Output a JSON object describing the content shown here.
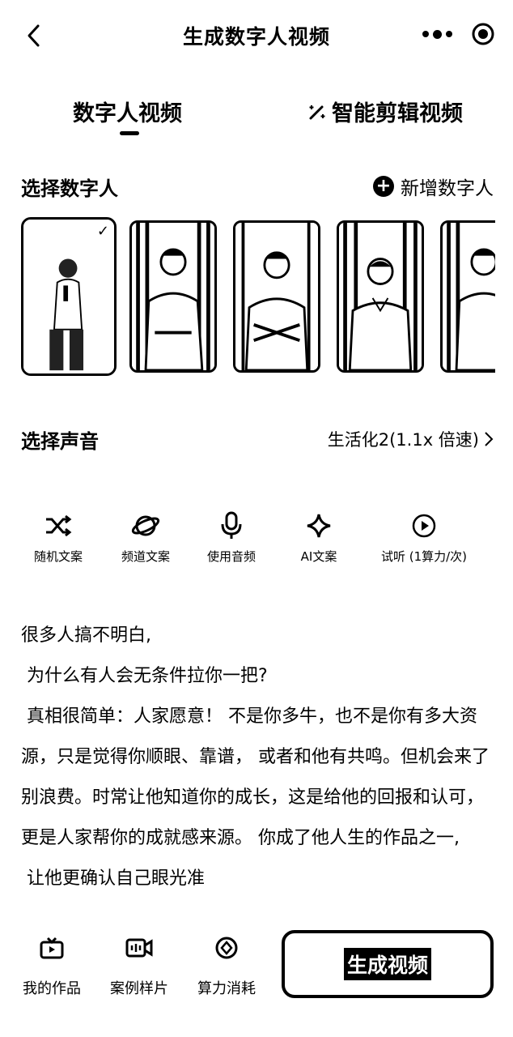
{
  "header": {
    "title": "生成数字人视频"
  },
  "tabs": [
    {
      "label": "数字人视频",
      "active": true
    },
    {
      "label": "智能剪辑视频",
      "active": false
    }
  ],
  "avatar_section": {
    "title": "选择数字人",
    "add_label": "新增数字人",
    "selected_index": 0
  },
  "voice_section": {
    "title": "选择声音",
    "value": "生活化2(1.1x 倍速)"
  },
  "tools": [
    {
      "label": "随机文案",
      "icon": "shuffle-icon"
    },
    {
      "label": "频道文案",
      "icon": "planet-icon"
    },
    {
      "label": "使用音频",
      "icon": "microphone-icon"
    },
    {
      "label": "AI文案",
      "icon": "sparkle-icon"
    },
    {
      "label": "试听 (1算力/次)",
      "icon": "play-circle-icon"
    }
  ],
  "script": {
    "paragraphs": [
      "很多人搞不明白,",
      " 为什么有人会无条件拉你一把?",
      " 真相很简单：人家愿意！ 不是你多牛，也不是你有多大资源，只是觉得你顺眼、靠谱， 或者和他有共鸣。但机会来了别浪费。时常让他知道你的成长，这是给他的回报和认可，更是人家帮你的成就感来源。 你成了他人生的作品之一,",
      " 让他更确认自己眼光准"
    ]
  },
  "bottom_nav": [
    {
      "label": "我的作品",
      "icon": "tv-icon"
    },
    {
      "label": "案例样片",
      "icon": "video-camera-icon"
    },
    {
      "label": "算力消耗",
      "icon": "coin-icon"
    }
  ],
  "generate_label": "生成视频"
}
